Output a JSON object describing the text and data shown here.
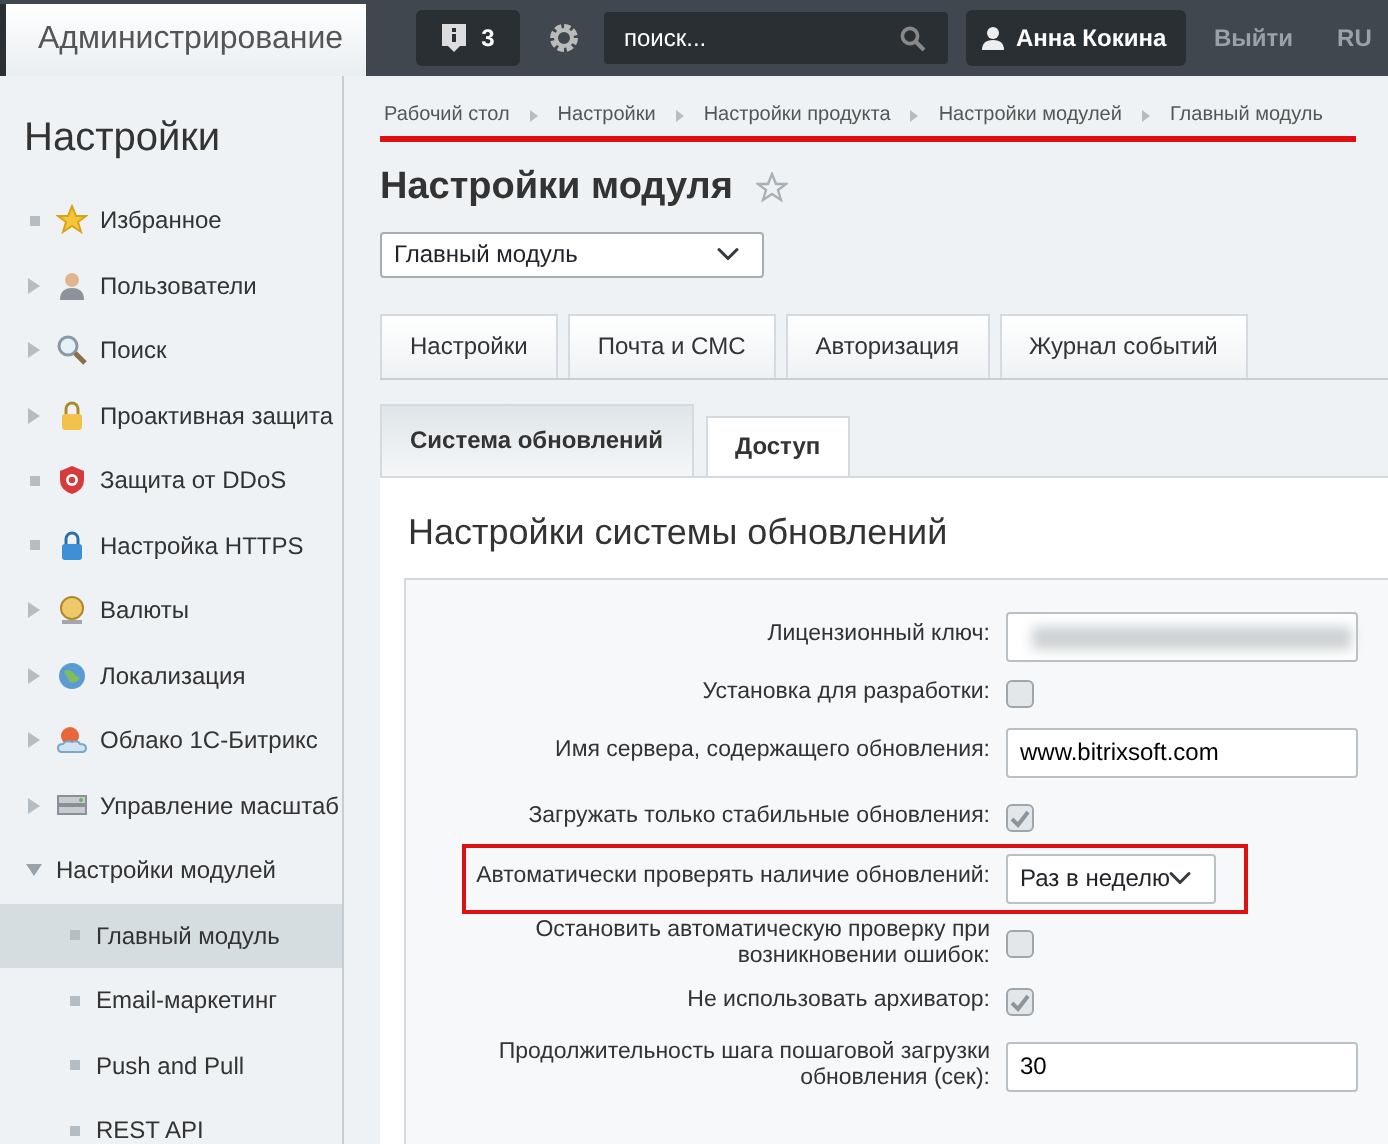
{
  "header": {
    "title": "Администрирование",
    "notifications": "3",
    "search": {
      "placeholder": "поиск..."
    },
    "user": "Анна Кокина",
    "logout": "Выйти",
    "language": "RU"
  },
  "sidebar": {
    "title": "Настройки",
    "items": [
      {
        "label": "Избранное",
        "kind": "leaf",
        "selected": false
      },
      {
        "label": "Пользователи",
        "kind": "folder",
        "expanded": false,
        "selected": false
      },
      {
        "label": "Поиск",
        "kind": "folder",
        "expanded": false,
        "selected": false
      },
      {
        "label": "Проактивная защита",
        "kind": "folder",
        "expanded": false,
        "selected": false
      },
      {
        "label": "Защита от DDoS",
        "kind": "leaf",
        "selected": false
      },
      {
        "label": "Настройка HTTPS",
        "kind": "leaf",
        "selected": false
      },
      {
        "label": "Валюты",
        "kind": "folder",
        "expanded": false,
        "selected": false
      },
      {
        "label": "Локализация",
        "kind": "folder",
        "expanded": false,
        "selected": false
      },
      {
        "label": "Облако 1С-Битрикс",
        "kind": "folder",
        "expanded": false,
        "selected": false
      },
      {
        "label": "Управление масштаб",
        "kind": "folder",
        "expanded": false,
        "selected": false
      },
      {
        "label": "Настройки модулей",
        "kind": "folder",
        "expanded": true,
        "selected": false,
        "children": [
          {
            "label": "Главный модуль",
            "kind": "leaf",
            "selected": true
          },
          {
            "label": "Email-маркетинг",
            "kind": "leaf",
            "selected": false
          },
          {
            "label": "Push and Pull",
            "kind": "leaf",
            "selected": false
          },
          {
            "label": "REST API",
            "kind": "leaf",
            "selected": false
          }
        ]
      }
    ]
  },
  "breadcrumbs": {
    "highlighted": true,
    "items": [
      "Рабочий стол",
      "Настройки",
      "Настройки продукта",
      "Настройки модулей",
      "Главный модуль"
    ]
  },
  "page_title": "Настройки модуля",
  "favorite": false,
  "module_select": {
    "value": "Главный модуль"
  },
  "tabs": [
    {
      "label": "Настройки",
      "selected": false
    },
    {
      "label": "Почта и СМС",
      "selected": false
    },
    {
      "label": "Авторизация",
      "selected": false
    },
    {
      "label": "Журнал событий",
      "selected": false
    }
  ],
  "subtabs": [
    {
      "label": "Система обновлений",
      "selected": true
    },
    {
      "label": "Доступ",
      "selected": false
    }
  ],
  "section_title": "Настройки системы обновлений",
  "fields": [
    {
      "label": "Лицензионный ключ:",
      "kind": "masked",
      "highlighted": false
    },
    {
      "label": "Установка для разработки:",
      "kind": "checkbox",
      "checked": false,
      "highlighted": false
    },
    {
      "label": "Имя сервера, содержащего обновления:",
      "kind": "text",
      "value": "www.bitrixsoft.com",
      "highlighted": false
    },
    {
      "label": "Загружать только стабильные обновления:",
      "kind": "checkbox",
      "checked": true,
      "highlighted": false
    },
    {
      "label": "Автоматически проверять наличие обновлений:",
      "kind": "select",
      "value": "Раз в неделю",
      "highlighted": true
    },
    {
      "label": "Остановить автоматическую проверку при возникновении ошибок:",
      "kind": "checkbox",
      "checked": false,
      "highlighted": false
    },
    {
      "label": "Не использовать архиватор:",
      "kind": "checkbox",
      "checked": true,
      "highlighted": false
    },
    {
      "label": "Продолжительность шага пошаговой загрузки обновления (сек):",
      "kind": "text",
      "value": "30",
      "highlighted": false
    }
  ]
}
